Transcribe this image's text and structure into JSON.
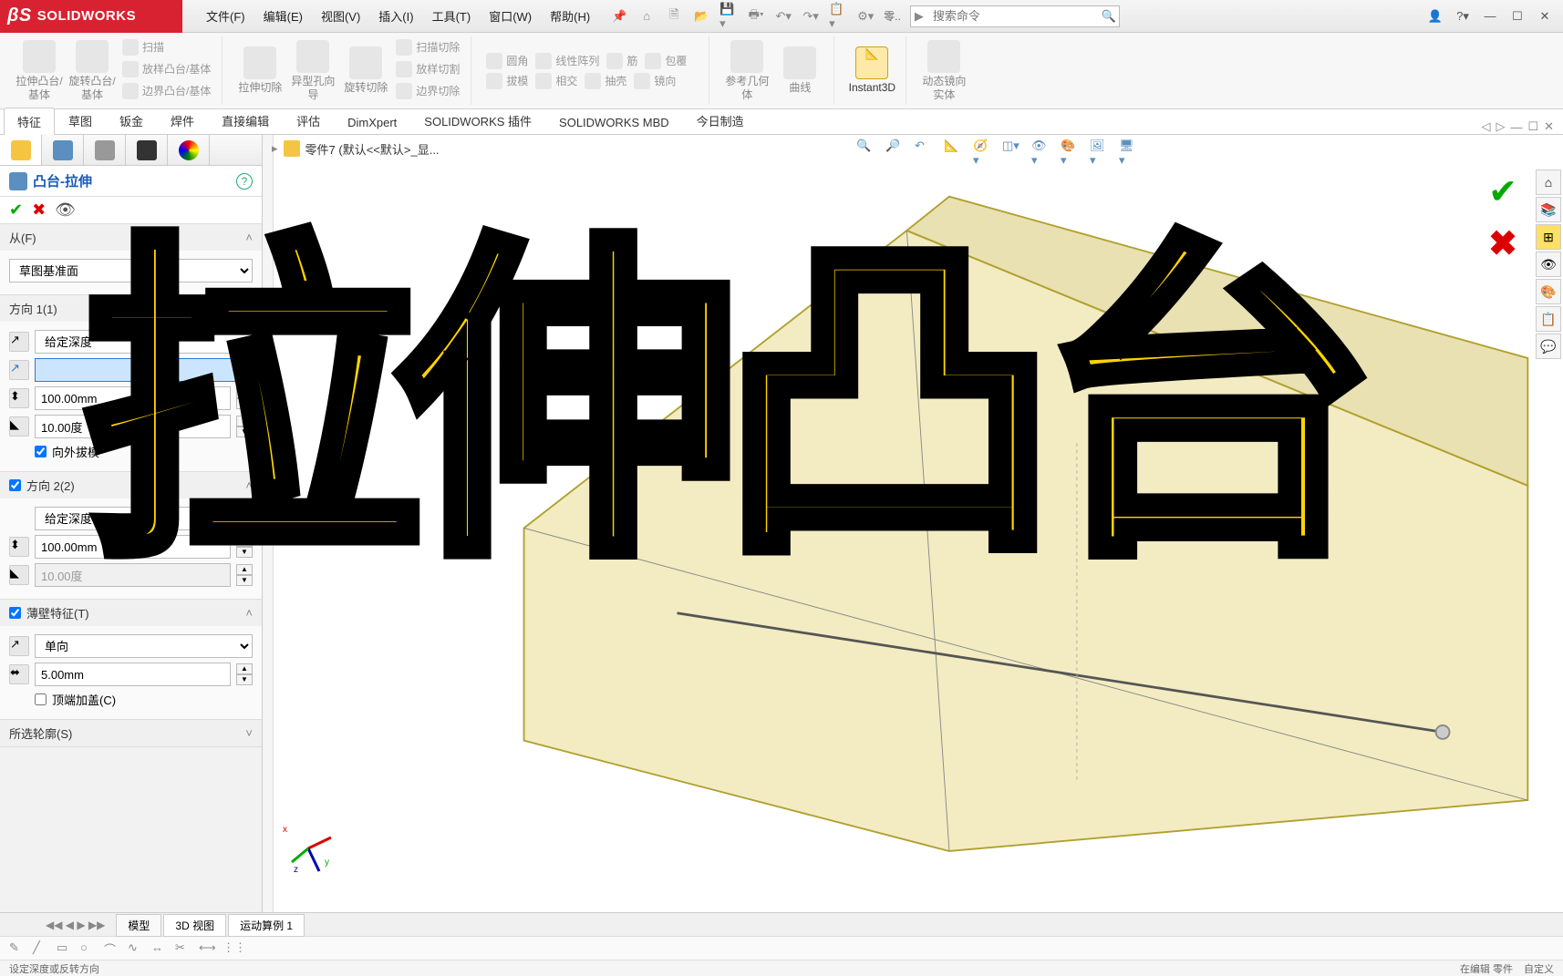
{
  "app": {
    "name": "SOLIDWORKS"
  },
  "menu": [
    "文件(F)",
    "编辑(E)",
    "视图(V)",
    "插入(I)",
    "工具(T)",
    "窗口(W)",
    "帮助(H)"
  ],
  "search": {
    "placeholder": "搜索命令"
  },
  "ribbon": {
    "big_buttons": [
      {
        "label": "拉伸凸台/基体"
      },
      {
        "label": "旋转凸台/基体"
      }
    ],
    "small_col1": [
      "扫描",
      "放样凸台/基体",
      "边界凸台/基体"
    ],
    "big2": [
      {
        "label": "拉伸切除"
      },
      {
        "label": "异型孔向导"
      },
      {
        "label": "旋转切除"
      }
    ],
    "small_col2": [
      "扫描切除",
      "放样切割",
      "边界切除"
    ],
    "big3": [
      {
        "label": "圆角"
      },
      {
        "label": "线性阵列"
      },
      {
        "label": "筋"
      },
      {
        "label": "拔模"
      },
      {
        "label": "抽壳"
      },
      {
        "label": "包覆"
      },
      {
        "label": "相交"
      },
      {
        "label": "镜向"
      }
    ],
    "big4": [
      {
        "label": "参考几何体"
      },
      {
        "label": "曲线"
      },
      {
        "label": "Instant3D",
        "active": true
      },
      {
        "label": "动态镜向实体"
      }
    ]
  },
  "tabs": [
    "特征",
    "草图",
    "钣金",
    "焊件",
    "直接编辑",
    "评估",
    "DimXpert",
    "SOLIDWORKS 插件",
    "SOLIDWORKS MBD",
    "今日制造"
  ],
  "active_tab": "特征",
  "breadcrumb": "零件7  (默认<<默认>_显...",
  "panel": {
    "title": "凸台-拉伸",
    "from": {
      "label": "从(F)",
      "value": "草图基准面"
    },
    "dir1": {
      "label": "方向 1(1)",
      "type": "给定深度",
      "depth": "100.00mm",
      "draft": "10.00度",
      "outward": "向外拔模",
      "depth_input": ""
    },
    "dir2": {
      "label": "方向 2(2)",
      "type": "给定深度",
      "depth": "100.00mm",
      "draft": "10.00度",
      "checked": true
    },
    "thin": {
      "label": "薄壁特征(T)",
      "type": "单向",
      "thickness": "5.00mm",
      "cap": "顶端加盖(C)",
      "checked": true
    },
    "contour": {
      "label": "所选轮廓(S)"
    }
  },
  "bottom_tabs": [
    "模型",
    "3D 视图",
    "运动算例 1"
  ],
  "status": {
    "left": "设定深度或反转方向",
    "right": [
      "在编辑 零件",
      "自定义"
    ]
  },
  "overlay": "拉伸凸台"
}
